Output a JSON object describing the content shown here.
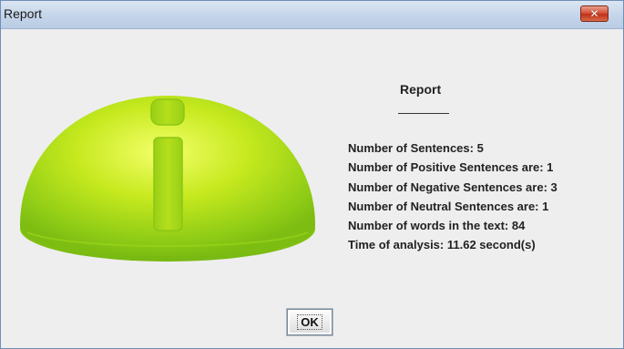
{
  "window": {
    "title": "Report",
    "close_icon": "close-icon"
  },
  "report": {
    "heading": "Report",
    "lines": [
      "Number of Sentences: 5",
      "Number of Positive Sentences are: 1",
      "Number of Negative Sentences are: 3",
      "Number of Neutral Sentences are: 1",
      "Number of words in the text: 84",
      "Time of analysis: 11.62 second(s)"
    ]
  },
  "graphic": {
    "icon": "info-icon",
    "color": "#b8e21c"
  },
  "buttons": {
    "ok_label": "OK"
  },
  "colors": {
    "titlebar": "#c6d6ea",
    "close_button": "#c0301b",
    "background": "#eeeeee"
  }
}
